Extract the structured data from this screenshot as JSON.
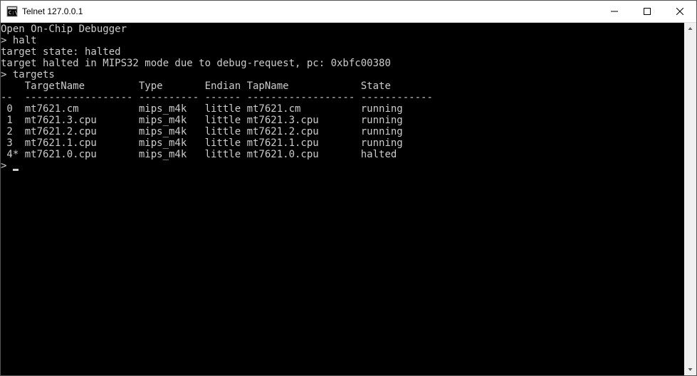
{
  "window": {
    "title": "Telnet 127.0.0.1"
  },
  "terminal": {
    "lines": [
      "Open On-Chip Debugger",
      "> halt",
      "target state: halted",
      "target halted in MIPS32 mode due to debug-request, pc: 0xbfc00380",
      "> targets",
      "    TargetName         Type       Endian TapName            State       ",
      "--  ------------------ ---------- ------ ------------------ ------------",
      " 0  mt7621.cm          mips_m4k   little mt7621.cm          running",
      " 1  mt7621.3.cpu       mips_m4k   little mt7621.3.cpu       running",
      " 2  mt7621.2.cpu       mips_m4k   little mt7621.2.cpu       running",
      " 3  mt7621.1.cpu       mips_m4k   little mt7621.1.cpu       running",
      " 4* mt7621.0.cpu       mips_m4k   little mt7621.0.cpu       halted",
      "> "
    ]
  }
}
